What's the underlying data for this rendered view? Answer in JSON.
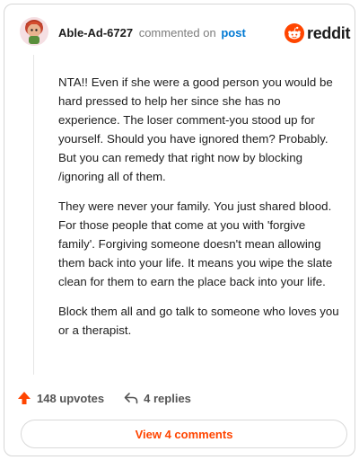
{
  "header": {
    "username": "Able-Ad-6727",
    "commented_text": "commented on",
    "post_link": "post",
    "logo_text": "reddit",
    "logo_color": "#ff4500"
  },
  "comment": {
    "paragraphs": [
      "NTA!! Even if she were a good person you would be hard pressed to help her since she has no experience. The loser comment-you stood up for yourself. Should you have ignored them? Probably. But you can remedy that right now by blocking /ignoring all of them.",
      "They were never your family. You just shared blood. For those people that come at you with 'forgive family'. Forgiving someone doesn't mean allowing them back into your life. It means you wipe the slate clean for them to earn the place back into your life.",
      "Block them all and go talk to someone who loves you or a therapist."
    ]
  },
  "actions": {
    "upvotes": "148 upvotes",
    "replies": "4 replies",
    "upvote_icon": "upvote-arrow-icon",
    "reply_icon": "reply-arrow-icon"
  },
  "footer": {
    "view_comments": "View 4 comments"
  }
}
